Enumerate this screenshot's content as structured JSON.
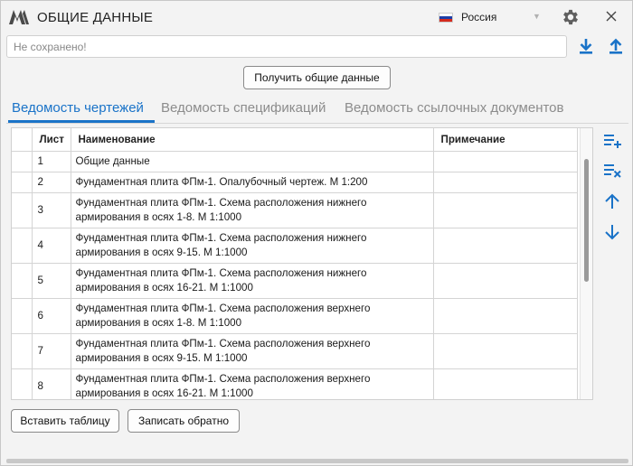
{
  "window": {
    "title": "ОБЩИЕ ДАННЫЕ",
    "country": "Россия"
  },
  "status": {
    "placeholder": "Не сохранено!"
  },
  "actions": {
    "get_data": "Получить общие данные",
    "insert_table": "Вставить таблицу",
    "write_back": "Записать обратно"
  },
  "tabs": [
    {
      "label": "Ведомость чертежей",
      "active": true
    },
    {
      "label": "Ведомость спецификаций",
      "active": false
    },
    {
      "label": "Ведомость ссылочных документов",
      "active": false
    }
  ],
  "grid": {
    "columns": [
      "Лист",
      "Наименование",
      "Примечание"
    ],
    "rows": [
      {
        "sheet": "1",
        "name": "Общие данные",
        "note": ""
      },
      {
        "sheet": "2",
        "name": "Фундаментная плита ФПм-1. Опалубочный чертеж. М 1:200",
        "note": ""
      },
      {
        "sheet": "3",
        "name": "Фундаментная плита ФПм-1. Схема расположения нижнего армирования в осях 1-8. М 1:1000",
        "note": ""
      },
      {
        "sheet": "4",
        "name": "Фундаментная плита ФПм-1. Схема расположения нижнего армирования в осях 9-15. М 1:1000",
        "note": ""
      },
      {
        "sheet": "5",
        "name": "Фундаментная плита ФПм-1. Схема расположения нижнего армирования в осях 16-21. М 1:1000",
        "note": ""
      },
      {
        "sheet": "6",
        "name": "Фундаментная плита ФПм-1. Схема расположения верхнего армирования в осях 1-8. М 1:1000",
        "note": ""
      },
      {
        "sheet": "7",
        "name": "Фундаментная плита ФПм-1. Схема расположения верхнего армирования в осях 9-15. М 1:1000",
        "note": ""
      },
      {
        "sheet": "8",
        "name": "Фундаментная плита ФПм-1. Схема расположения верхнего армирования в осях 16-21. М 1:1000",
        "note": ""
      }
    ]
  },
  "icons": {
    "logo": "logo-icon",
    "settings": "gear-icon",
    "close": "close-icon",
    "download": "download-icon",
    "upload": "upload-icon",
    "add_row": "add-row-icon",
    "delete_row": "delete-row-icon",
    "move_up": "arrow-up-icon",
    "move_down": "arrow-down-icon"
  },
  "colors": {
    "accent": "#1a73c8",
    "flag": [
      "#ffffff",
      "#1c3fa8",
      "#d52b1e"
    ]
  }
}
